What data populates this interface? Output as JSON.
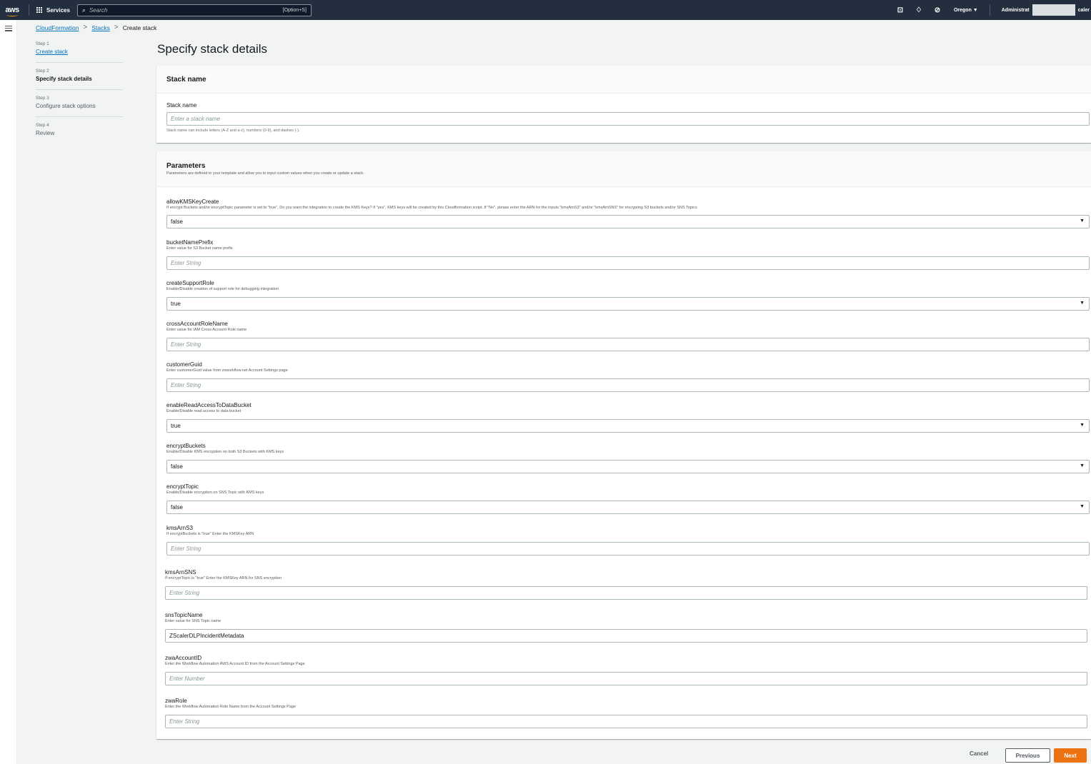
{
  "topnav": {
    "logo": "aws",
    "services_label": "Services",
    "search_placeholder": "Search",
    "search_shortcut": "[Option+S]",
    "region": "Oregon ▼",
    "account": "Administrat",
    "account_suffix": "caler"
  },
  "breadcrumb": {
    "items": [
      "CloudFormation",
      "Stacks",
      "Create stack"
    ]
  },
  "steps": [
    {
      "num": "Step 1",
      "title": "Create stack"
    },
    {
      "num": "Step 2",
      "title": "Specify stack details"
    },
    {
      "num": "Step 3",
      "title": "Configure stack options"
    },
    {
      "num": "Step 4",
      "title": "Review"
    }
  ],
  "page_title": "Specify stack details",
  "stack_name_panel": {
    "title": "Stack name",
    "label": "Stack name",
    "placeholder": "Enter a stack name",
    "hint": "Stack name can include letters (A-Z and a-z), numbers (0-9), and dashes (-)."
  },
  "parameters_panel": {
    "title": "Parameters",
    "description": "Parameters are defined in your template and allow you to input custom values when you create or update a stack.",
    "fields": [
      {
        "name": "allowKMSKeyCreate",
        "desc": "If encrypt Buckets and/or encryptTopic parameter is set to \"true\", Do you want the integration to create the KMS Keys? If \"yes\", KMS keys will be created by this Cloudformation script. If \"No\", please enter the ARN for the inputs \"kmsArnS3\" and/or \"kmsArnSNS\" for encrypting S3 buckets and/or SNS Topics",
        "type": "select",
        "value": "false"
      },
      {
        "name": "bucketNamePrefix",
        "desc": "Enter value for S3 Bucket name prefix",
        "type": "text",
        "placeholder": "Enter String"
      },
      {
        "name": "createSupportRole",
        "desc": "Enable/Disable creation of support role for debugging integration",
        "type": "select",
        "value": "true"
      },
      {
        "name": "crossAccountRoleName",
        "desc": "Enter value for IAM Cross Account Role name",
        "type": "text",
        "placeholder": "Enter String"
      },
      {
        "name": "customerGuid",
        "desc": "Enter customerGuid value from zsworkflow.net Account Settings page",
        "type": "text",
        "placeholder": "Enter String"
      },
      {
        "name": "enableReadAccessToDataBucket",
        "desc": "Enable/Disable read access to data bucket",
        "type": "select",
        "value": "true"
      },
      {
        "name": "encryptBuckets",
        "desc": "Enable/Disable KMS encryption on both S3 Buckets with KMS keys",
        "type": "select",
        "value": "false"
      },
      {
        "name": "encryptTopic",
        "desc": "Enable/Disable encryption on SNS Topic with KMS keys",
        "type": "select",
        "value": "false"
      },
      {
        "name": "kmsArnS3",
        "desc": "If encryptBuckets is \"true\" Enter the KMSKey ARN",
        "type": "text",
        "placeholder": "Enter String"
      },
      {
        "name": "kmsArnSNS",
        "desc": "If encryptTopic is \"true\" Enter the KMSKey ARN for SNS encryption",
        "type": "text",
        "placeholder": "Enter String"
      },
      {
        "name": "snsTopicName",
        "desc": "Enter value for SNS Topic name",
        "type": "text",
        "value": "ZScalerDLPIncidentMetadata"
      },
      {
        "name": "zwaAccountID",
        "desc": "Enter the Workflow Automation AWS Account ID from the Account Settings Page",
        "type": "text",
        "placeholder": "Enter Number"
      },
      {
        "name": "zwaRole",
        "desc": "Enter the Workflow Automation Role Name from the Account Settings Page",
        "type": "text",
        "placeholder": "Enter String"
      }
    ]
  },
  "footer": {
    "cancel": "Cancel",
    "previous": "Previous",
    "next": "Next"
  }
}
